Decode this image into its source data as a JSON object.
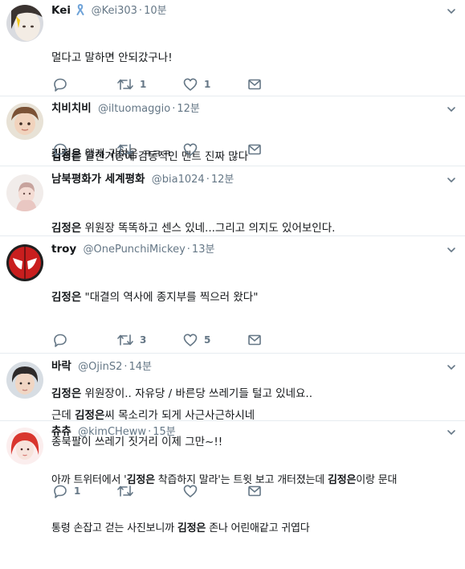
{
  "tweets": [
    {
      "name": "Kei",
      "handle": "@Kei303",
      "time": "10분",
      "lines": [
        [
          {
            "t": "멀다고 말하면 안되갔구나!",
            "b": false
          }
        ],
        [],
        [
          {
            "t": "김정은",
            "b": true
          },
          {
            "t": " 왤캐 귀여움 ㅋㅋㅋ",
            "b": false
          }
        ]
      ],
      "retweets": "1",
      "likes": "1",
      "replies": ""
    },
    {
      "name": "치비치비",
      "handle": "@iltuomaggio",
      "time": "12분",
      "lines": [
        [
          {
            "t": "김정은",
            "b": true
          },
          {
            "t": " 말한거중에 감동적인 멘트 진짜 많다",
            "b": false
          }
        ]
      ],
      "retweets": "",
      "likes": "",
      "replies": ""
    },
    {
      "name": "남북평화가 세계평화",
      "handle": "@bia1024",
      "time": "12분",
      "lines": [
        [
          {
            "t": "김정은",
            "b": true
          },
          {
            "t": " 위원장 똑똑하고 센스 있네...그리고 의지도 있어보인다.",
            "b": false
          }
        ]
      ],
      "retweets": "",
      "likes": "",
      "replies": ""
    },
    {
      "name": "troy",
      "handle": "@OnePunchiMickey",
      "time": "13분",
      "lines": [
        [
          {
            "t": "김정은",
            "b": true
          },
          {
            "t": " \"대결의 역사에 종지부를 찍으러 왔다\"",
            "b": false
          }
        ],
        [],
        [
          {
            "t": "김정은",
            "b": true
          },
          {
            "t": " 위원장이.. 자유당 / 바른당 쓰레기들 털고 있네요..",
            "b": false
          }
        ],
        [
          {
            "t": "종북팔이 쓰레기 짓거리 이제 그만~!!",
            "b": false
          }
        ]
      ],
      "retweets": "3",
      "likes": "5",
      "replies": ""
    },
    {
      "name": "바락",
      "handle": "@OjinS2",
      "time": "14분",
      "lines": [
        [
          {
            "t": "근데 ",
            "b": false
          },
          {
            "t": "김정은",
            "b": true
          },
          {
            "t": "씨 목소리가 되게 사근사근하시네",
            "b": false
          }
        ]
      ],
      "retweets": "",
      "likes": "",
      "replies": ""
    },
    {
      "name": "츄츄",
      "handle": "@kimCHeww",
      "time": "15분",
      "lines": [
        [
          {
            "t": "아까 트위터에서 '",
            "b": false
          },
          {
            "t": "김정은",
            "b": true
          },
          {
            "t": " 착즙하지 말라'는 트윗 보고 개터졌는데 ",
            "b": false
          },
          {
            "t": "김정은",
            "b": true
          },
          {
            "t": "이랑 문대",
            "b": false
          }
        ],
        [
          {
            "t": "통령 손잡고 걷는 사진보니까 ",
            "b": false
          },
          {
            "t": "김정은",
            "b": true
          },
          {
            "t": " 존나 어린애같고 귀엽다",
            "b": false
          }
        ]
      ],
      "retweets": "",
      "likes": "",
      "replies": "1"
    }
  ],
  "icons": {
    "reply": "reply-icon",
    "retweet": "retweet-icon",
    "like": "heart-icon",
    "dm": "envelope-icon",
    "more": "chevron-down-icon",
    "badge": "ribbon-icon"
  },
  "colors": {
    "icon": "#657786",
    "text": "#14171a",
    "muted": "#657786",
    "divider": "#e6ecf0",
    "ribbon": "#6fa3d8"
  }
}
